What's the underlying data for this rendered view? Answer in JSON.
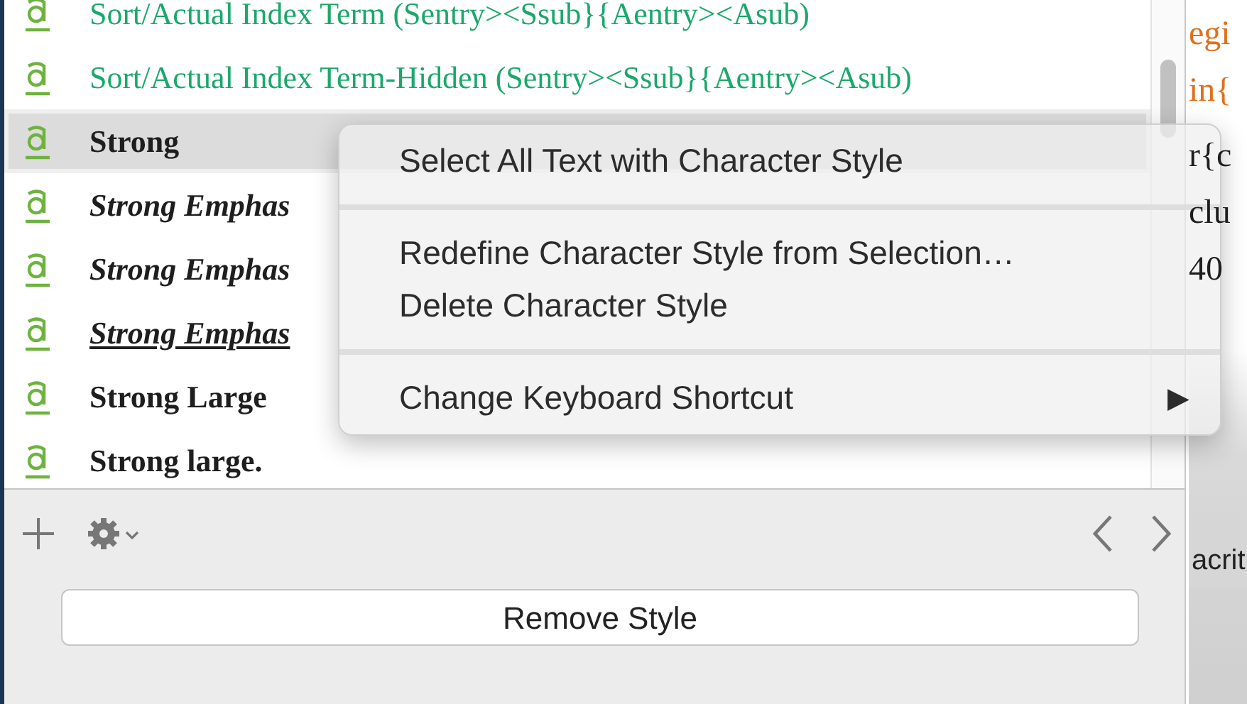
{
  "styles": [
    {
      "name": "Sort/Actual Index Term (Sentry><Ssub}{Aentry><Asub)",
      "kind": "index",
      "selected": false
    },
    {
      "name": "Sort/Actual Index Term-Hidden (Sentry><Ssub}{Aentry><Asub)",
      "kind": "index",
      "selected": false
    },
    {
      "name": "Strong",
      "kind": "bold",
      "selected": true
    },
    {
      "name": "Strong Emphas",
      "kind": "bold-italic",
      "selected": false
    },
    {
      "name": "Strong Emphas",
      "kind": "bold-italic",
      "selected": false
    },
    {
      "name": "Strong Emphas",
      "kind": "bold-italic-underline",
      "selected": false
    },
    {
      "name": "Strong Large",
      "kind": "bold",
      "selected": false
    },
    {
      "name": "Strong large.",
      "kind": "bold",
      "selected": false
    }
  ],
  "context_menu": [
    {
      "kind": "item",
      "label": "Select All Text with Character Style"
    },
    {
      "kind": "separator"
    },
    {
      "kind": "item",
      "label": "Redefine Character Style from Selection…"
    },
    {
      "kind": "item",
      "label": "Delete Character Style"
    },
    {
      "kind": "separator"
    },
    {
      "kind": "submenu",
      "label": "Change Keyboard Shortcut",
      "arrow": "▶"
    }
  ],
  "remove_button": "Remove Style",
  "editor_lines": [
    {
      "text": "egi",
      "kind": "command"
    },
    {
      "text": "in{",
      "kind": "command"
    },
    {
      "text": "r{c",
      "kind": "plain"
    },
    {
      "text": "clu",
      "kind": "plain"
    },
    {
      "text": "40",
      "kind": "plain"
    }
  ],
  "editor_status": "acrit"
}
